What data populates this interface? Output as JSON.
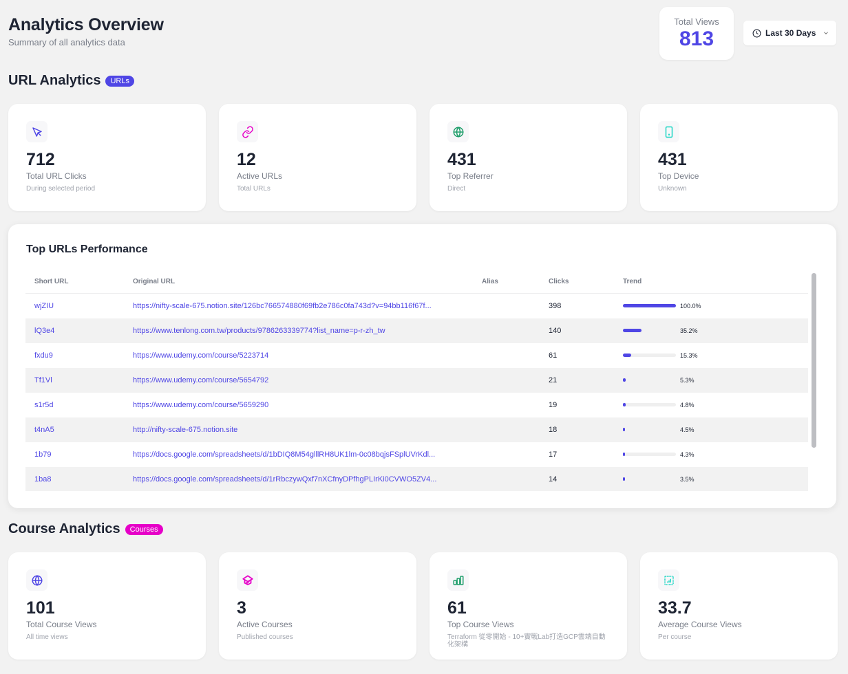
{
  "header": {
    "title": "Analytics Overview",
    "subtitle": "Summary of all analytics data"
  },
  "total_views": {
    "label": "Total Views",
    "value": "813"
  },
  "date_range": {
    "label": "Last 30 Days",
    "icon": "clock-icon"
  },
  "url_section": {
    "title": "URL Analytics",
    "badge": "URLs",
    "badge_color": "#4f46e5",
    "cards": [
      {
        "icon": "cursor-icon",
        "color": "#4f46e5",
        "value": "712",
        "label": "Total URL Clicks",
        "sub": "During selected period"
      },
      {
        "icon": "link-icon",
        "color": "#e600c8",
        "value": "12",
        "label": "Active URLs",
        "sub": "Total URLs"
      },
      {
        "icon": "globe-icon",
        "color": "#1e9e6a",
        "value": "431",
        "label": "Top Referrer",
        "sub": "Direct"
      },
      {
        "icon": "device-icon",
        "color": "#1dd6c4",
        "value": "431",
        "label": "Top Device",
        "sub": "Unknown"
      }
    ]
  },
  "top_urls": {
    "title": "Top URLs Performance",
    "columns": [
      "Short URL",
      "Original URL",
      "Alias",
      "Clicks",
      "Trend"
    ],
    "rows": [
      {
        "short": "wjZIU",
        "original": "https://nifty-scale-675.notion.site/126bc766574880f69fb2e786c0fa743d?v=94bb116f67f...",
        "alias": "",
        "clicks": "398",
        "trend_pct": 100.0,
        "trend_label": "100.0%"
      },
      {
        "short": "lQ3e4",
        "original": "https://www.tenlong.com.tw/products/9786263339774?list_name=p-r-zh_tw",
        "alias": "",
        "clicks": "140",
        "trend_pct": 35.2,
        "trend_label": "35.2%"
      },
      {
        "short": "fxdu9",
        "original": "https://www.udemy.com/course/5223714",
        "alias": "",
        "clicks": "61",
        "trend_pct": 15.3,
        "trend_label": "15.3%"
      },
      {
        "short": "Tf1Vl",
        "original": "https://www.udemy.com/course/5654792",
        "alias": "",
        "clicks": "21",
        "trend_pct": 5.3,
        "trend_label": "5.3%"
      },
      {
        "short": "s1r5d",
        "original": "https://www.udemy.com/course/5659290",
        "alias": "",
        "clicks": "19",
        "trend_pct": 4.8,
        "trend_label": "4.8%"
      },
      {
        "short": "t4nA5",
        "original": "http://nifty-scale-675.notion.site",
        "alias": "",
        "clicks": "18",
        "trend_pct": 4.5,
        "trend_label": "4.5%"
      },
      {
        "short": "1b79",
        "original": "https://docs.google.com/spreadsheets/d/1bDIQ8M54glllRH8UK1lm-0c08bqjsFSplUVrKdl...",
        "alias": "",
        "clicks": "17",
        "trend_pct": 4.3,
        "trend_label": "4.3%"
      },
      {
        "short": "1ba8",
        "original": "https://docs.google.com/spreadsheets/d/1rRbczywQxf7nXCfnyDPfhgPLIrKi0CVWO5ZV4...",
        "alias": "",
        "clicks": "14",
        "trend_pct": 3.5,
        "trend_label": "3.5%"
      }
    ]
  },
  "course_section": {
    "title": "Course Analytics",
    "badge": "Courses",
    "badge_color": "#e600c8",
    "cards": [
      {
        "icon": "globe-icon",
        "color": "#4f46e5",
        "value": "101",
        "label": "Total Course Views",
        "sub": "All time views"
      },
      {
        "icon": "graduation-cap-icon",
        "color": "#e600c8",
        "value": "3",
        "label": "Active Courses",
        "sub": "Published courses"
      },
      {
        "icon": "bar-chart-icon",
        "color": "#1e9e6a",
        "value": "61",
        "label": "Top Course Views",
        "sub": "Terraform 從零開始 - 10+實戰Lab打造GCP雲端自動化架構"
      },
      {
        "icon": "chart-square-icon",
        "color": "#1dd6c4",
        "value": "33.7",
        "label": "Average Course Views",
        "sub": "Per course"
      }
    ]
  }
}
